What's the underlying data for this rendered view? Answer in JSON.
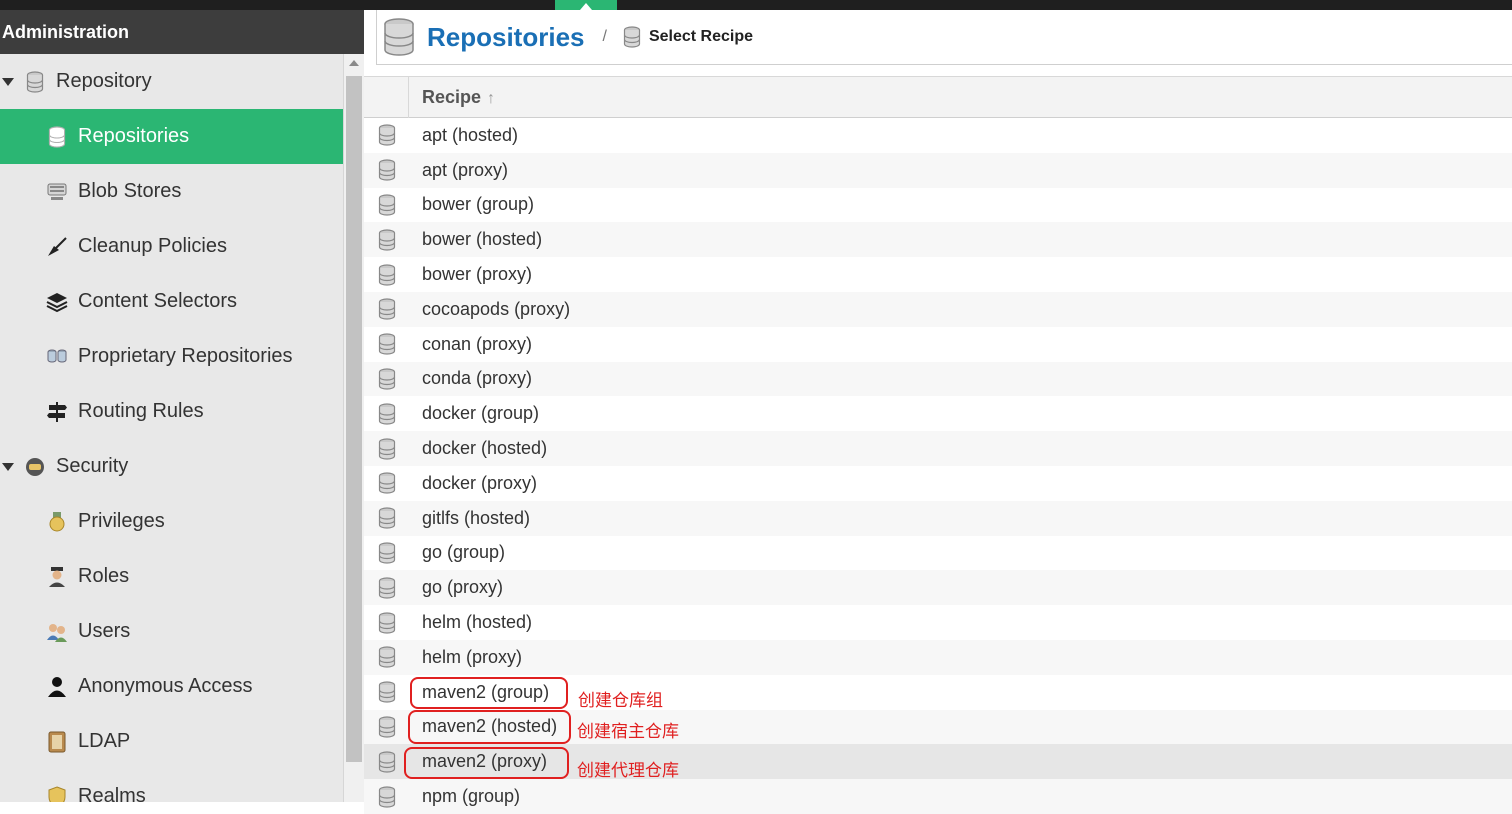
{
  "sidebar": {
    "title": "Administration",
    "items": [
      {
        "label": "Repository",
        "type": "group",
        "icon": "database-icon"
      },
      {
        "label": "Repositories",
        "type": "child",
        "icon": "database-icon",
        "active": true
      },
      {
        "label": "Blob Stores",
        "type": "child",
        "icon": "server-icon"
      },
      {
        "label": "Cleanup Policies",
        "type": "child",
        "icon": "broom-icon"
      },
      {
        "label": "Content Selectors",
        "type": "child",
        "icon": "layers-icon"
      },
      {
        "label": "Proprietary Repositories",
        "type": "child",
        "icon": "proprietary-icon"
      },
      {
        "label": "Routing Rules",
        "type": "child",
        "icon": "signpost-icon"
      },
      {
        "label": "Security",
        "type": "group",
        "icon": "security-icon"
      },
      {
        "label": "Privileges",
        "type": "child",
        "icon": "medal-icon"
      },
      {
        "label": "Roles",
        "type": "child",
        "icon": "role-icon"
      },
      {
        "label": "Users",
        "type": "child",
        "icon": "users-icon"
      },
      {
        "label": "Anonymous Access",
        "type": "child",
        "icon": "user-icon"
      },
      {
        "label": "LDAP",
        "type": "child",
        "icon": "book-icon"
      },
      {
        "label": "Realms",
        "type": "child",
        "icon": "shield-icon"
      }
    ]
  },
  "main": {
    "title": "Repositories",
    "breadcrumb_separator": "/",
    "breadcrumb": "Select Recipe",
    "column_header": "Recipe",
    "sort_indicator": "↑",
    "rows": [
      "apt (hosted)",
      "apt (proxy)",
      "bower (group)",
      "bower (hosted)",
      "bower (proxy)",
      "cocoapods (proxy)",
      "conan (proxy)",
      "conda (proxy)",
      "docker (group)",
      "docker (hosted)",
      "docker (proxy)",
      "gitlfs (hosted)",
      "go (group)",
      "go (proxy)",
      "helm (hosted)",
      "helm (proxy)",
      "maven2 (group)",
      "maven2 (hosted)",
      "maven2 (proxy)",
      "npm (group)"
    ]
  },
  "annotations": {
    "group": "创建仓库组",
    "hosted": "创建宿主仓库",
    "proxy": "创建代理仓库"
  },
  "colors": {
    "accent": "#2bb673",
    "title_blue": "#1a6fb5",
    "annotation_red": "#e02020"
  }
}
